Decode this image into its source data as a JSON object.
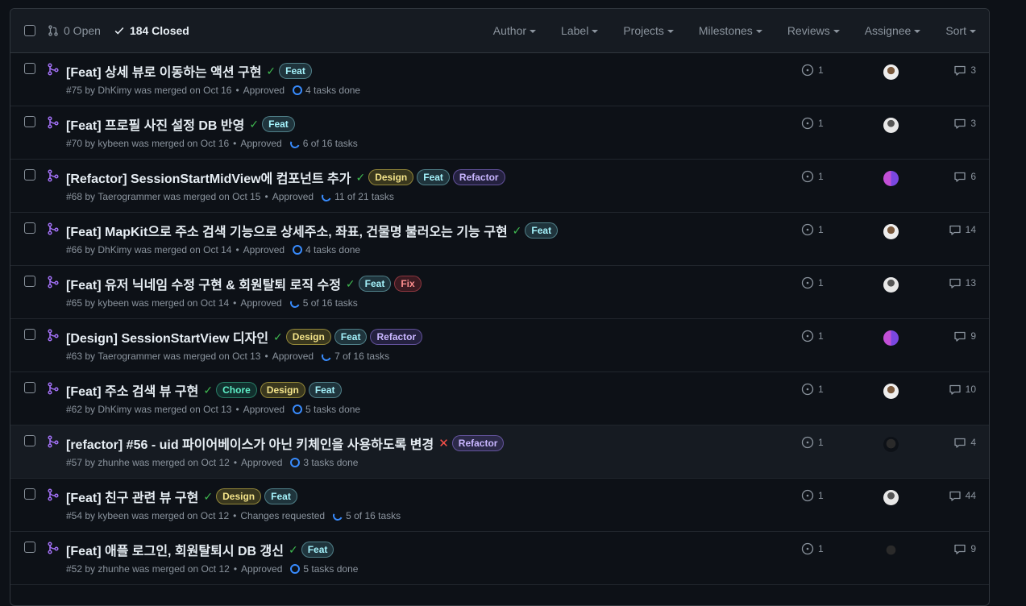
{
  "header": {
    "open_label": "0 Open",
    "closed_label": "184 Closed",
    "filters": [
      "Author",
      "Label",
      "Projects",
      "Milestones",
      "Reviews",
      "Assignee",
      "Sort"
    ]
  },
  "colors": {
    "merged_icon": "#a371f7",
    "check": "#3fb950",
    "fail": "#f85149",
    "task_progress": "#388bfd"
  },
  "prs": [
    {
      "title": "[Feat] 상세 뷰로 이동하는 액션 구현",
      "status": "success",
      "labels": [
        "Feat"
      ],
      "number": "#75",
      "author": "DhKimy",
      "merged_text": "was merged on Oct 16",
      "review": "Approved",
      "tasks": "4 tasks done",
      "tasks_icon": "done",
      "issues": "1",
      "comments": "3",
      "avatar": "av-a"
    },
    {
      "title": "[Feat] 프로필 사진 설정 DB 반영",
      "status": "success",
      "labels": [
        "Feat"
      ],
      "number": "#70",
      "author": "kybeen",
      "merged_text": "was merged on Oct 16",
      "review": "Approved",
      "tasks": "6 of 16 tasks",
      "tasks_icon": "partial",
      "issues": "1",
      "comments": "3",
      "avatar": "av-b"
    },
    {
      "title": "[Refactor] SessionStartMidView에 컴포넌트 추가",
      "status": "success",
      "labels": [
        "Design",
        "Feat",
        "Refactor"
      ],
      "number": "#68",
      "author": "Taerogrammer",
      "merged_text": "was merged on Oct 15",
      "review": "Approved",
      "tasks": "11 of 21 tasks",
      "tasks_icon": "partial",
      "issues": "1",
      "comments": "6",
      "avatar": "av-c"
    },
    {
      "title": "[Feat] MapKit으로 주소 검색 기능으로 상세주소, 좌표, 건물명 불러오는 기능 구현",
      "status": "success",
      "labels": [
        "Feat"
      ],
      "number": "#66",
      "author": "DhKimy",
      "merged_text": "was merged on Oct 14",
      "review": "Approved",
      "tasks": "4 tasks done",
      "tasks_icon": "done",
      "issues": "1",
      "comments": "14",
      "avatar": "av-a"
    },
    {
      "title": "[Feat] 유저 닉네임 수정 구현 & 회원탈퇴 로직 수정",
      "status": "success",
      "labels": [
        "Feat",
        "Fix"
      ],
      "number": "#65",
      "author": "kybeen",
      "merged_text": "was merged on Oct 14",
      "review": "Approved",
      "tasks": "5 of 16 tasks",
      "tasks_icon": "partial",
      "issues": "1",
      "comments": "13",
      "avatar": "av-b"
    },
    {
      "title": "[Design] SessionStartView 디자인",
      "status": "success",
      "labels": [
        "Design",
        "Feat",
        "Refactor"
      ],
      "number": "#63",
      "author": "Taerogrammer",
      "merged_text": "was merged on Oct 13",
      "review": "Approved",
      "tasks": "7 of 16 tasks",
      "tasks_icon": "partial",
      "issues": "1",
      "comments": "9",
      "avatar": "av-c"
    },
    {
      "title": "[Feat] 주소 검색 뷰 구현",
      "status": "success",
      "labels": [
        "Chore",
        "Design",
        "Feat"
      ],
      "number": "#62",
      "author": "DhKimy",
      "merged_text": "was merged on Oct 13",
      "review": "Approved",
      "tasks": "5 tasks done",
      "tasks_icon": "done",
      "issues": "1",
      "comments": "10",
      "avatar": "av-a"
    },
    {
      "title": "[refactor] #56 - uid 파이어베이스가 아닌 키체인을 사용하도록 변경",
      "status": "failure",
      "labels": [
        "Refactor"
      ],
      "number": "#57",
      "author": "zhunhe",
      "merged_text": "was merged on Oct 12",
      "review": "Approved",
      "tasks": "3 tasks done",
      "tasks_icon": "done",
      "issues": "1",
      "comments": "4",
      "avatar": "av-d",
      "highlight": true
    },
    {
      "title": "[Feat] 친구 관련 뷰 구현",
      "status": "success",
      "labels": [
        "Design",
        "Feat"
      ],
      "number": "#54",
      "author": "kybeen",
      "merged_text": "was merged on Oct 12",
      "review": "Changes requested",
      "tasks": "5 of 16 tasks",
      "tasks_icon": "partial",
      "issues": "1",
      "comments": "44",
      "avatar": "av-b"
    },
    {
      "title": "[Feat] 애플 로그인, 회원탈퇴시 DB 갱신",
      "status": "success",
      "labels": [
        "Feat"
      ],
      "number": "#52",
      "author": "zhunhe",
      "merged_text": "was merged on Oct 12",
      "review": "Approved",
      "tasks": "5 tasks done",
      "tasks_icon": "done",
      "issues": "1",
      "comments": "9",
      "avatar": "av-d"
    }
  ]
}
